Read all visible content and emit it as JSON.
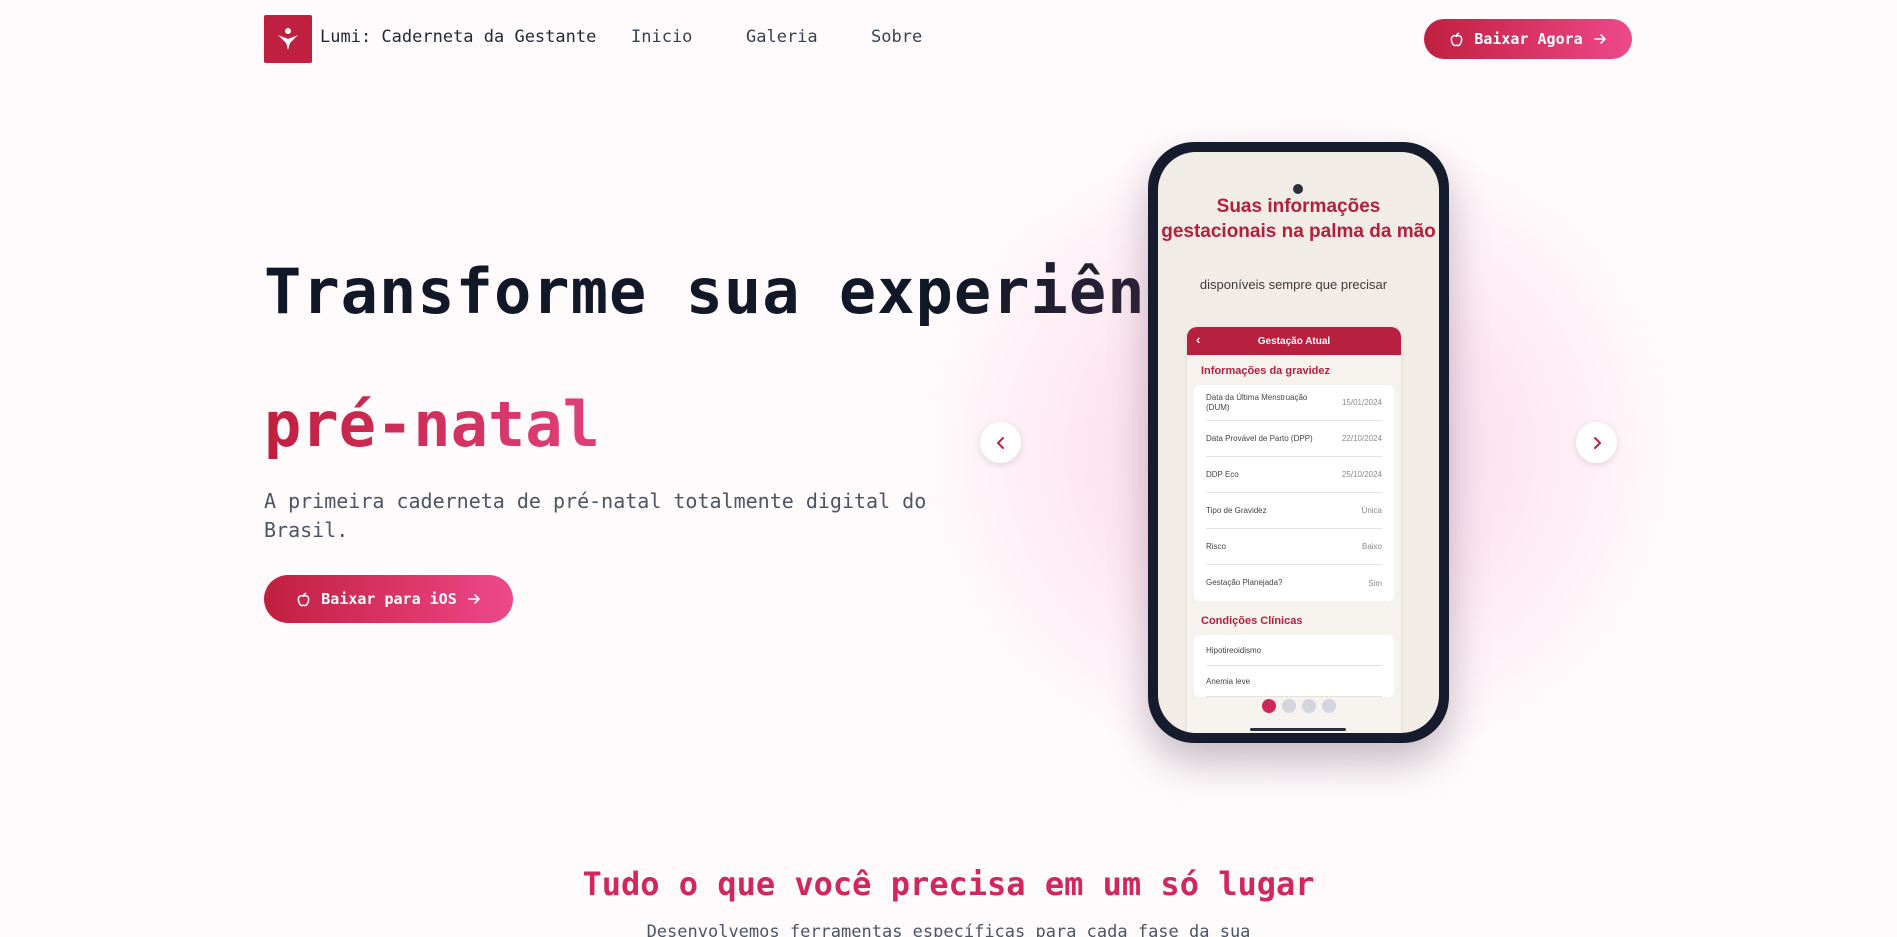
{
  "nav": {
    "brand": "Lumi: Caderneta da Gestante",
    "links": [
      "Inicio",
      "Galeria",
      "Sobre"
    ],
    "cta_label": "Baixar Agora",
    "cta_icon": "apple-icon",
    "cta_arrow_icon": "arrow-right-icon"
  },
  "hero": {
    "title": "Transforme sua experiência",
    "title_accent": "pré-natal",
    "subtitle": "A primeira caderneta de pré-natal totalmente digital do Brasil.",
    "cta_label": "Baixar para iOS"
  },
  "carousel": {
    "prev_icon": "chevron-left-icon",
    "next_icon": "chevron-right-icon",
    "active_slide": 1,
    "slide_count": 4,
    "screen": {
      "title": "Suas informações gestacionais na palma da mão",
      "subtitle": "disponíveis sempre que precisar",
      "header": "Gestação Atual",
      "section1": "Informações da gravidez",
      "rows": [
        {
          "label": "Data da Última Menstruação (DUM)",
          "value": "15/01/2024"
        },
        {
          "label": "Data Provável de Parto (DPP)",
          "value": "22/10/2024"
        },
        {
          "label": "DDP Eco",
          "value": "25/10/2024"
        },
        {
          "label": "Tipo de Gravidez",
          "value": "Única"
        },
        {
          "label": "Risco",
          "value": "Baixo"
        },
        {
          "label": "Gestação Planejada?",
          "value": "Sim"
        }
      ],
      "section2": "Condições Clínicas",
      "conditions": [
        "Hipotireoidismo",
        "Anemia leve"
      ]
    }
  },
  "features": {
    "heading": "Tudo o que você precisa em um só lugar",
    "description": "Desenvolvemos ferramentas específicas para cada fase da sua"
  },
  "colors": {
    "brand": "#c0203f",
    "accent": "#e23b73",
    "pink": "#ec4a8c"
  }
}
